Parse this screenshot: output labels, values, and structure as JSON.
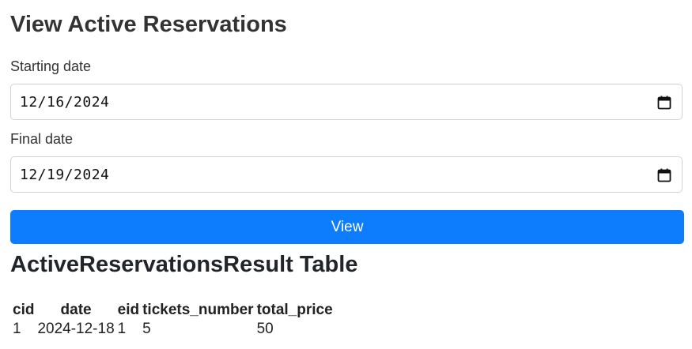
{
  "page": {
    "title": "View Active Reservations"
  },
  "form": {
    "start_label": "Starting date",
    "start_value": "12/16/2024",
    "end_label": "Final date",
    "end_value": "12/19/2024",
    "submit_label": "View",
    "accent_color": "#0d7dfd"
  },
  "icons": {
    "date_picker": "calendar-icon"
  },
  "result": {
    "title": "ActiveReservationsResult Table",
    "columns": [
      "cid",
      "date",
      "eid",
      "tickets_number",
      "total_price"
    ],
    "rows": [
      [
        "1",
        "2024-12-18",
        "1",
        "5",
        "50"
      ]
    ]
  }
}
